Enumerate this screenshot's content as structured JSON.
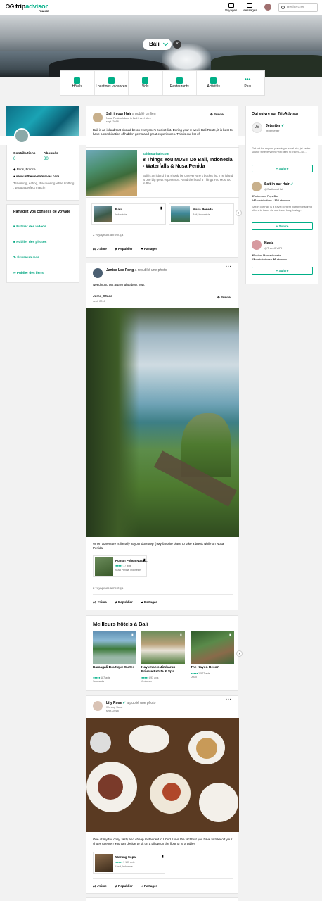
{
  "header": {
    "logo_main": "trip",
    "logo_accent": "advisor",
    "logo_sub": "FRANCE",
    "nav": [
      {
        "label": "Voyages"
      },
      {
        "label": "Messages"
      }
    ],
    "search_placeholder": "Rechercher"
  },
  "hero": {
    "location": "Bali"
  },
  "categories": [
    {
      "label": "Hôtels",
      "icon": "bed-icon"
    },
    {
      "label": "Locations vacances",
      "icon": "house-icon"
    },
    {
      "label": "Vols",
      "icon": "plane-icon"
    },
    {
      "label": "Restaurants",
      "icon": "fork-knife-icon"
    },
    {
      "label": "Activités",
      "icon": "ticket-icon"
    },
    {
      "label": "Plus",
      "icon": "more-icon"
    }
  ],
  "profile": {
    "contributions_label": "Contributions",
    "contributions": "6",
    "followers_label": "Abonnés",
    "followers": "30",
    "location": "Paris, France",
    "website": "www.inthewoolofsloves.com",
    "bio": "Travelling, eating, discovering while knitting : what a perfect match!"
  },
  "share": {
    "title": "Partagez vos conseils de voyage",
    "items": [
      {
        "label": "Publier des vidéos",
        "icon": "video-icon"
      },
      {
        "label": "Publier des photos",
        "icon": "camera-icon"
      },
      {
        "label": "Écrire un avis",
        "icon": "pencil-icon"
      },
      {
        "label": "Publier des liens",
        "icon": "link-icon"
      }
    ]
  },
  "who_to_follow": {
    "title": "Qui suivre sur TripAdvisor",
    "follow_label": "Suivre",
    "users": [
      {
        "name": "Jetsetter",
        "handle": "@Jetsetter",
        "snippet": "Get set for anyone planning a travel trip, jet-setter source for everything you need to travel—so..."
      },
      {
        "name": "Salt in our Hair",
        "handle": "@SaltinourHair",
        "stats_a": "9",
        "stats_a_label": "Rotterdam, Pays-Bas",
        "stats_b": "140",
        "stats_b_label": "contributions",
        "stats_c": "124",
        "stats_c_label": "abonnés",
        "snippet": "Salt in our Hair is a travel content platform inspiring others to travel via our travel blog, instag..."
      },
      {
        "name": "Neele",
        "handle": "@TravelPal70",
        "stats_a": "9",
        "stats_a_label": "Boston, Massachusetts",
        "stats_b": "13",
        "stats_b_label": "contributions",
        "stats_c": "36",
        "stats_c_label": "abonnés"
      }
    ]
  },
  "feed": {
    "post1": {
      "author": "Salt in our Hair",
      "action": "a publié un lien",
      "location": "Nusa Penida Island in Bali travel sites",
      "date": "sept. 2018",
      "follow": "Suivre",
      "text": "Bali is an island that should be on everyone's bucket list. During your 3-week Bali Route, it is best to have a combination of hidden gems and great experiences. This is our list of",
      "link_domain": "saltinourhair.com",
      "link_title": "8 Things You MUST Do Bali, Indonesia - Waterfalls & Nusa Penida",
      "link_desc": "Bali is an island that should be on everyone's bucket list. The island is one big great experience. Read the list of 8 Things You Must Do in Bali.",
      "places": [
        {
          "name": "Bali",
          "sub": "Indonésie"
        },
        {
          "name": "Nusa Penida",
          "sub": "Bali, Indonésie"
        }
      ],
      "likes": "2 voyageurs aiment ça"
    },
    "actions": {
      "like": "J'aime",
      "repost": "Republier",
      "share": "Partager"
    },
    "post2": {
      "author": "Janice Lee Fong",
      "action": "a republié une photo",
      "text": "Needing to get away right about now.",
      "orig_author": "Jems_Stead",
      "orig_date": "sept. 2018",
      "follow": "Suivre",
      "caption": "When adventure is literally at your doorstep :) My favorite place to take a break while on Nusa Penida",
      "place_name": "Rumah Pohon Nusa ...",
      "place_reviews": "17 avis",
      "place_sub": "Nusa Penida, Indonésie",
      "likes": "2 voyageurs aiment ça"
    },
    "best_hotels": {
      "title": "Meilleurs hôtels à Bali",
      "hotels": [
        {
          "name": "Kamagali Boutique Suites",
          "reviews": "187 avis",
          "city": "Sukasada"
        },
        {
          "name": "Kayumanis Jimbaran Private Estate & Spa",
          "reviews": "893 avis",
          "city": "Jimbaran"
        },
        {
          "name": "The Kayon Resort",
          "reviews": "1 577 avis",
          "city": "Ubud"
        }
      ]
    },
    "post3": {
      "author": "Lily Rose",
      "action": "a publié une photo",
      "location": "Warung Sopa",
      "date": "sept. 2018",
      "caption": "One of my fav cosy, tasty and cheap restaurant in Ubud. Love the fact that you have to take off your shoes to enter! You can decide to sit on a pillow on the floor or at a table!",
      "place_name": "Warung Sopa",
      "place_reviews": "1 105 avis",
      "place_sub": "Ubud, Indonésie"
    }
  },
  "colors": {
    "accent": "#00af87",
    "link": "#00a680"
  }
}
